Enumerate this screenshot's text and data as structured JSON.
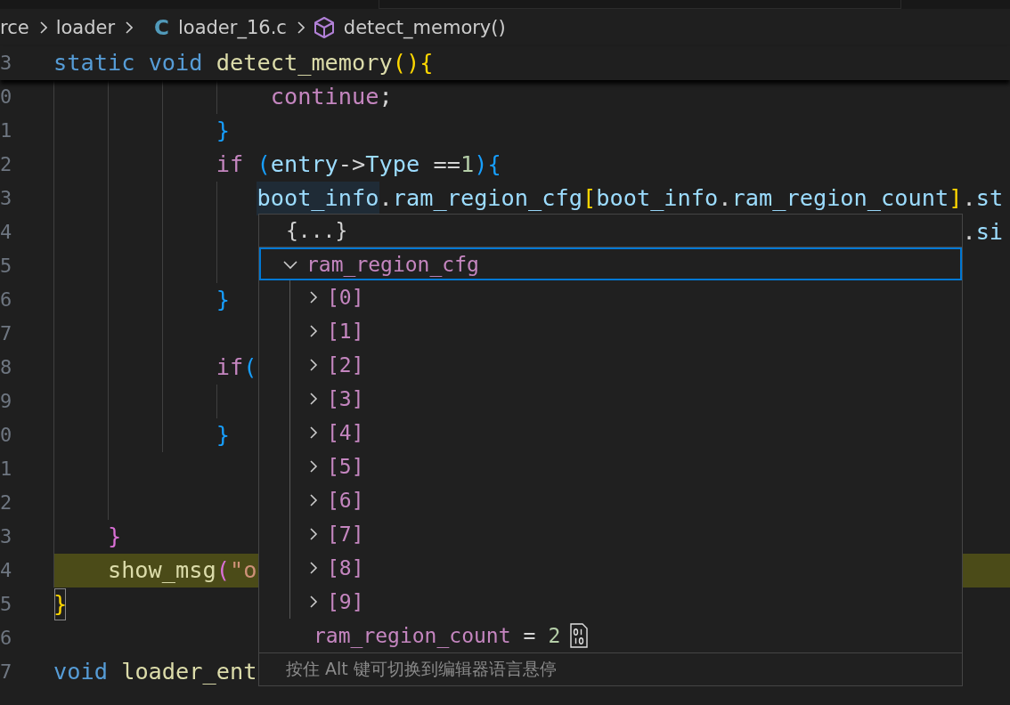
{
  "breadcrumb": [
    {
      "text": "rce",
      "kind": "folder"
    },
    {
      "text": "loader",
      "kind": "folder"
    },
    {
      "text": "loader_16.c",
      "kind": "file",
      "icon": "C"
    },
    {
      "text": "detect_memory()",
      "kind": "symbol"
    }
  ],
  "sticky_line": {
    "number": "3",
    "tokens": [
      {
        "text": "static",
        "kind": "keyword"
      },
      {
        "text": " void",
        "kind": "keyword"
      },
      {
        "text": " detect_memory",
        "kind": "function"
      },
      {
        "text": "(){",
        "kind": "bracket1"
      }
    ]
  },
  "lines": [
    {
      "number": "0",
      "current": false,
      "tokens": [
        {
          "text": "                continue",
          "kind": "control"
        },
        {
          "text": ";",
          "kind": "plain"
        }
      ]
    },
    {
      "number": "1",
      "current": false,
      "tokens": [
        {
          "text": "            }",
          "kind": "bracket3"
        }
      ]
    },
    {
      "number": "2",
      "current": false,
      "tokens": [
        {
          "text": "            if",
          "kind": "control"
        },
        {
          "text": " (",
          "kind": "bracket3"
        },
        {
          "text": "entry",
          "kind": "variable"
        },
        {
          "text": "->",
          "kind": "plain"
        },
        {
          "text": "Type",
          "kind": "variable"
        },
        {
          "text": " ==",
          "kind": "plain"
        },
        {
          "text": "1",
          "kind": "number"
        },
        {
          "text": "){",
          "kind": "bracket3"
        }
      ]
    },
    {
      "number": "3",
      "current": false,
      "tokens": [
        {
          "text": "               boot_info",
          "kind": "word-highlight"
        },
        {
          "text": ".",
          "kind": "plain"
        },
        {
          "text": "ram_region_cfg",
          "kind": "variable"
        },
        {
          "text": "[",
          "kind": "bracket1"
        },
        {
          "text": "boot_info",
          "kind": "variable"
        },
        {
          "text": ".",
          "kind": "plain"
        },
        {
          "text": "ram_region_count",
          "kind": "variable"
        },
        {
          "text": "]",
          "kind": "bracket1"
        },
        {
          "text": ".",
          "kind": "plain"
        },
        {
          "text": "st",
          "kind": "variable"
        }
      ]
    },
    {
      "number": "4",
      "current": false,
      "tokens": [
        {
          "text": "                                                                   .",
          "kind": "plain"
        },
        {
          "text": "si",
          "kind": "variable"
        }
      ]
    },
    {
      "number": "5",
      "current": false
    },
    {
      "number": "6",
      "current": false,
      "tokens": [
        {
          "text": "            }",
          "kind": "bracket3"
        }
      ]
    },
    {
      "number": "7",
      "current": false
    },
    {
      "number": "8",
      "current": false,
      "tokens": [
        {
          "text": "            if",
          "kind": "control"
        },
        {
          "text": "(",
          "kind": "bracket3"
        }
      ]
    },
    {
      "number": "9",
      "current": false
    },
    {
      "number": "0",
      "current": false,
      "tokens": [
        {
          "text": "            }",
          "kind": "bracket3"
        }
      ]
    },
    {
      "number": "1",
      "current": false
    },
    {
      "number": "2",
      "current": false
    },
    {
      "number": "3",
      "current": false,
      "tokens": [
        {
          "text": "    }",
          "kind": "bracket2"
        }
      ]
    },
    {
      "number": "4",
      "current": true,
      "tokens": [
        {
          "text": "    show_msg",
          "kind": "function"
        },
        {
          "text": "(",
          "kind": "bracket2"
        },
        {
          "text": "\"o",
          "kind": "string"
        }
      ]
    },
    {
      "number": "5",
      "current": false,
      "tokens": [
        {
          "text": "}",
          "kind": "bracket1-match"
        }
      ]
    },
    {
      "number": "6",
      "current": false
    },
    {
      "number": "7",
      "current": false,
      "tokens": [
        {
          "text": "void",
          "kind": "keyword"
        },
        {
          "text": " loader_ent",
          "kind": "function"
        }
      ]
    }
  ],
  "hover": {
    "header": "{...}",
    "tree": [
      {
        "kind": "group",
        "name": "ram_region_cfg",
        "expanded": true,
        "selected": true,
        "children": [
          {
            "kind": "group",
            "name": "[0]",
            "expanded": false,
            "selected": false
          },
          {
            "kind": "group",
            "name": "[1]",
            "expanded": false,
            "selected": false
          },
          {
            "kind": "group",
            "name": "[2]",
            "expanded": false,
            "selected": false
          },
          {
            "kind": "group",
            "name": "[3]",
            "expanded": false,
            "selected": false
          },
          {
            "kind": "group",
            "name": "[4]",
            "expanded": false,
            "selected": false
          },
          {
            "kind": "group",
            "name": "[5]",
            "expanded": false,
            "selected": false
          },
          {
            "kind": "group",
            "name": "[6]",
            "expanded": false,
            "selected": false
          },
          {
            "kind": "group",
            "name": "[7]",
            "expanded": false,
            "selected": false
          },
          {
            "kind": "group",
            "name": "[8]",
            "expanded": false,
            "selected": false
          },
          {
            "kind": "group",
            "name": "[9]",
            "expanded": false,
            "selected": false
          }
        ]
      },
      {
        "kind": "value",
        "name": "ram_region_count",
        "equals": "=",
        "value": "2",
        "selected": false
      }
    ],
    "footer": "按住 Alt 键可切换到编辑器语言悬停"
  }
}
